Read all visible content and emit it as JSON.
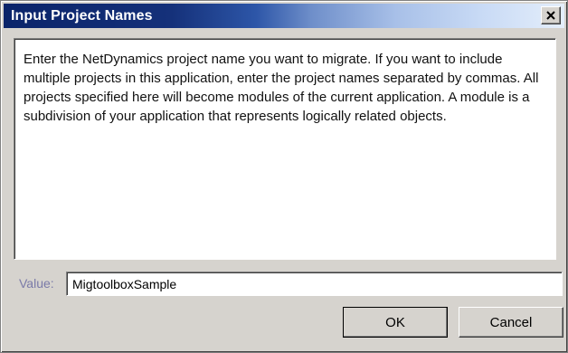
{
  "dialog": {
    "title": "Input Project Names",
    "close_icon": "close-icon",
    "message": "Enter the NetDynamics project name you want to migrate.  If you want to include multiple projects in this application, enter the project names separated by commas.  All projects specified here will become modules of the current application.  A module is a subdivision of your application that represents logically related objects.",
    "value_label": "Value:",
    "value": "MigtoolboxSample",
    "ok_label": "OK",
    "cancel_label": "Cancel"
  },
  "colors": {
    "title_gradient_start": "#0a246a",
    "title_gradient_end": "#e4eefb",
    "dialog_face": "#d6d3ce",
    "label_text": "#7a7aa8"
  }
}
